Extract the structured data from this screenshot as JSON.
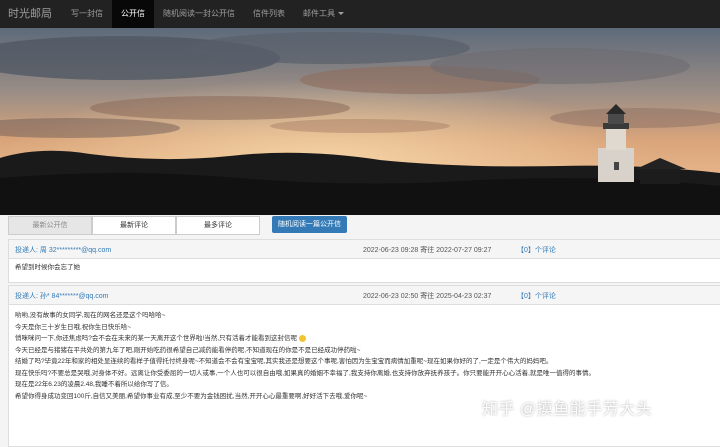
{
  "nav": {
    "brand": "时光邮局",
    "items": [
      "写一封信",
      "公开信",
      "随机阅读一封公开信",
      "信件列表",
      "邮件工具"
    ]
  },
  "tabs": [
    "最新公开信",
    "最新评论",
    "最多评论"
  ],
  "random_button": "随机阅读一篇公开信",
  "letters": [
    {
      "recipient": "投递人: 周 32*********@qq.com",
      "dates": "2022-06-23 09:28 寄往 2022-07-27 09:27",
      "comments": "【0】个评论",
      "lines": [
        "希望到时候你会忘了她"
      ]
    },
    {
      "recipient": "投递人: 孙* 84*******@qq.com",
      "dates": "2022-06-23 02:50 寄往 2025-04-23 02:37",
      "comments": "【0】个评论",
      "lines": [
        "哟哟,没有故事的女同学,现在的网名还是这个吗哈哈~",
        "今天是你三十岁生日哦,祝你生日快乐哈~",
        "悄咪咪问一下,你还焦虑吗?会不会在未来的某一天离开这个世界啦!当然,只有活着才能看到这封信呢",
        "今天已经是与猪猪在平共处的第九年了吧,刚开始吃药很希望自己减药能看停药呢,不知道现在的你是不是已经成功停药啦~",
        "结婚了吗?毕竟22年和家的相处显连续的看样子值得托付终身呢~不知道会不会有宝宝呢,其实我还是想要这个事呢,害怕因为生宝宝而病情加重呢~现在如果你好的了,一定是个伟大的妈妈吧。",
        "现在快乐吗?不要总是哭哦,对身体不好。远离让你受委屈的一切人或事,一个人也可以很自由哦,如果真的婚姻不幸福了,我支持你离婚,也支持你放弃抚养孩子。你只要能开开心心活着,就是唯一值得的事情。",
        "现在是22年6.23的凌晨2.48,我睡不着所以给你写了信。",
        "希望你得身成功变回100斤,自信又美丽,希望你事业有成,至少不要为金钱困扰,当然,开开心心最重要啊,好好活下去哦,爱你呢~"
      ]
    }
  ],
  "watermark": "知乎 @摸鱼能手芳大头"
}
